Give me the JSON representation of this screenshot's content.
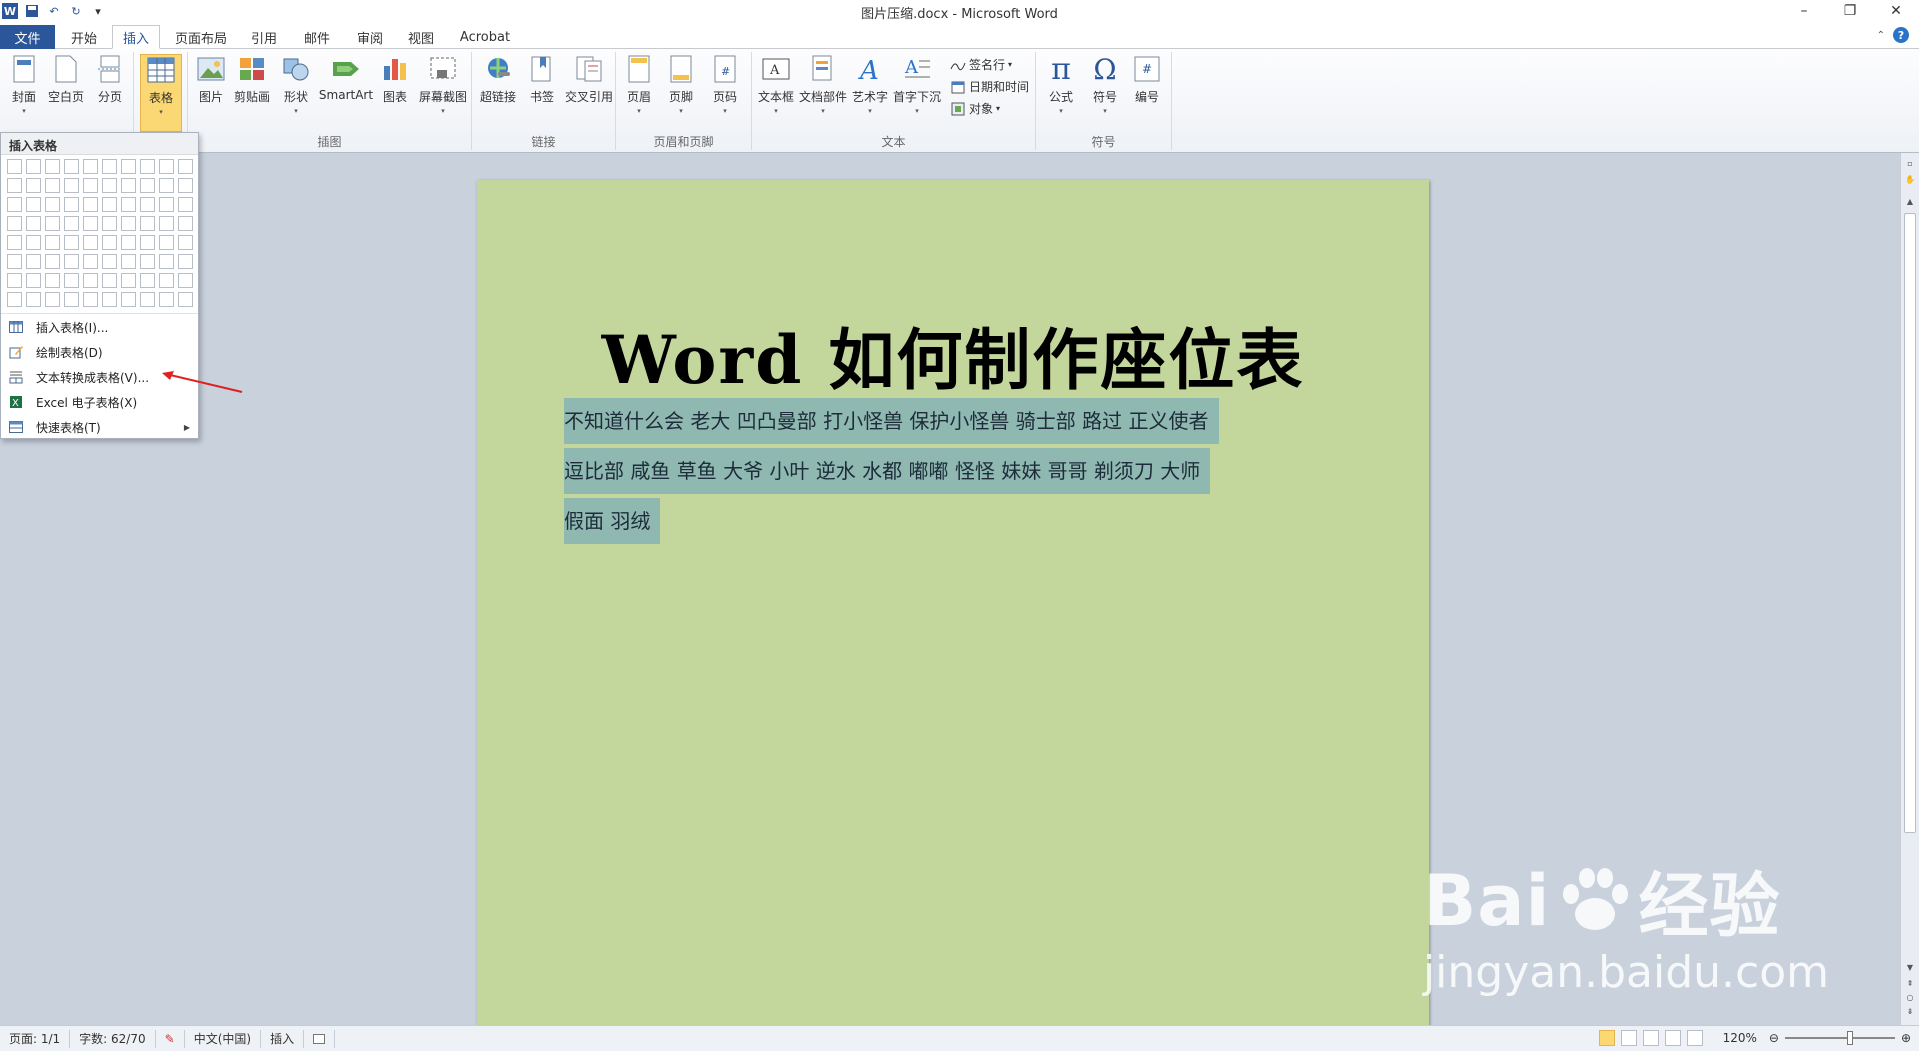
{
  "window": {
    "title": "图片压缩.docx - Microsoft Word",
    "minimize": "–",
    "restore": "❐",
    "close": "✕"
  },
  "qat": [
    "save-icon",
    "undo-icon",
    "redo-icon",
    "customize-icon"
  ],
  "tabs": [
    {
      "label": "文件",
      "key": "file"
    },
    {
      "label": "开始",
      "key": "home"
    },
    {
      "label": "插入",
      "key": "insert",
      "active": true
    },
    {
      "label": "页面布局",
      "key": "layout"
    },
    {
      "label": "引用",
      "key": "references"
    },
    {
      "label": "邮件",
      "key": "mailings"
    },
    {
      "label": "审阅",
      "key": "review"
    },
    {
      "label": "视图",
      "key": "view"
    },
    {
      "label": "Acrobat",
      "key": "acrobat"
    }
  ],
  "ribbon": {
    "pages_group": {
      "cover": "封面",
      "blank": "空白页",
      "break": "分页"
    },
    "table_btn": "表格",
    "illus_group": {
      "label": "插图",
      "picture": "图片",
      "clipart": "剪贴画",
      "shapes": "形状",
      "smartart": "SmartArt",
      "chart": "图表",
      "screenshot": "屏幕截图"
    },
    "links_group": {
      "label": "链接",
      "hyperlink": "超链接",
      "bookmark": "书签",
      "crossref": "交叉引用"
    },
    "hf_group": {
      "label": "页眉和页脚",
      "header": "页眉",
      "footer": "页脚",
      "pagenum": "页码"
    },
    "text_group": {
      "label": "文本",
      "textbox": "文本框",
      "quickparts": "文档部件",
      "wordart": "艺术字",
      "dropcap": "首字下沉",
      "signature": "签名行",
      "datetime": "日期和时间",
      "object": "对象"
    },
    "symbols_group": {
      "label": "符号",
      "equation": "公式",
      "symbol": "符号",
      "number": "编号"
    }
  },
  "dropdown": {
    "header": "插入表格",
    "items": [
      {
        "label": "插入表格(I)..."
      },
      {
        "label": "绘制表格(D)"
      },
      {
        "label": "文本转换成表格(V)..."
      },
      {
        "label": "Excel 电子表格(X)"
      },
      {
        "label": "快速表格(T)"
      }
    ]
  },
  "document": {
    "title": "Word 如何制作座位表",
    "line1": "不知道什么会  老大  凹凸曼部  打小怪兽  保护小怪兽  骑士部  路过  正义使者",
    "line2": "逗比部  咸鱼  草鱼  大爷  小叶  逆水  水都  嘟嘟  怪怪  妹妹  哥哥  剃须刀  大师",
    "line3": "假面  羽绒"
  },
  "status": {
    "page": "页面: 1/1",
    "words": "字数: 62/70",
    "lang": "中文(中国)",
    "mode": "插入",
    "zoom": "120%"
  },
  "watermark": {
    "line1": "Bai",
    "line1b": "经验",
    "line2": "jingyan.baidu.com"
  }
}
